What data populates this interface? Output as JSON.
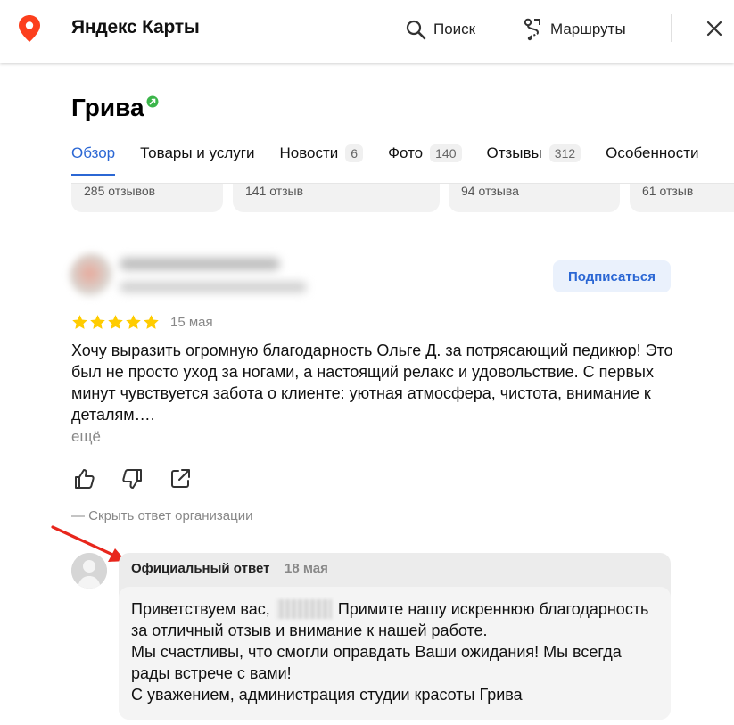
{
  "topbar": {
    "brand": "Яндекс Карты",
    "search_label": "Поиск",
    "routes_label": "Маршруты",
    "brand_color": "#fc3f1d"
  },
  "org": {
    "name": "Грива",
    "verified_color": "#3bb54a"
  },
  "tabs": [
    {
      "label": "Обзор",
      "count": null,
      "active": true
    },
    {
      "label": "Товары и услуги",
      "count": null,
      "active": false
    },
    {
      "label": "Новости",
      "count": "6",
      "active": false
    },
    {
      "label": "Фото",
      "count": "140",
      "active": false
    },
    {
      "label": "Отзывы",
      "count": "312",
      "active": false
    },
    {
      "label": "Особенности",
      "count": null,
      "active": false
    }
  ],
  "rating_cards": [
    "285 отзывов",
    "141 отзыв",
    "94 отзыва",
    "61 отзыв"
  ],
  "review": {
    "subscribe_label": "Подписаться",
    "rating": 5,
    "date": "15 мая",
    "text": "Хочу выразить огромную благодарность Ольге Д. за потрясающий педикюр! Это был не просто уход за ногами, а настоящий релакс и удовольствие. С первых минут чувствуется забота о клиенте: уютная атмосфера, чистота, внимание к деталям….",
    "more_label": "ещё",
    "star_color": "#ffcc00"
  },
  "actions": {
    "hide_answer_label": "— Скрыть ответ организации"
  },
  "answer": {
    "title": "Официальный ответ",
    "date": "18 мая",
    "text_greeting": "Приветствуем вас,",
    "text_body": "Примите нашу искреннюю благодарность за отличный отзыв и внимание к нашей работе.",
    "text_line3": "Мы счастливы, что смогли оправдать Ваши ожидания! Мы всегда рады встрече с вами!",
    "text_line4": "С уважением, администрация студии красоты Грива"
  },
  "colors": {
    "accent": "#2b67d4",
    "annotation_arrow": "#e8261c"
  }
}
